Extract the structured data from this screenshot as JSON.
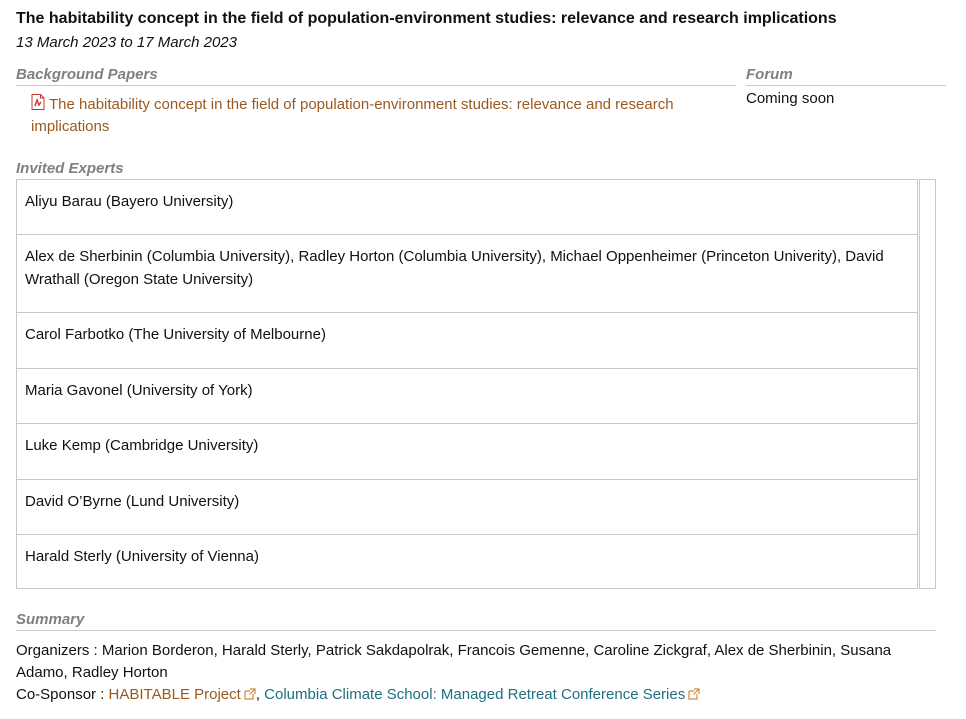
{
  "event": {
    "title": "The habitability concept in the field of population-environment studies: relevance and research implications",
    "dates": "13 March 2023 to 17 March 2023"
  },
  "background_papers": {
    "heading": "Background Papers",
    "items": [
      {
        "label": "The habitability concept in the field of population-environment studies: relevance and research implications",
        "icon": "pdf-icon"
      }
    ]
  },
  "forum": {
    "heading": "Forum",
    "text": "Coming soon"
  },
  "invited_experts": {
    "heading": "Invited Experts",
    "rows": [
      "Aliyu Barau (Bayero University)",
      "Alex de Sherbinin (Columbia University), Radley Horton (Columbia University), Michael Oppenheimer (Princeton Univerity), David Wrathall (Oregon State University)",
      "Carol Farbotko (The University of Melbourne)",
      "Maria Gavonel (University of York)",
      "Luke Kemp (Cambridge University)",
      "David O’Byrne (Lund University)",
      "Harald Sterly (University of Vienna)"
    ]
  },
  "summary": {
    "heading": "Summary",
    "organizers_label": "Organizers :",
    "organizers": "Marion Borderon, Harald Sterly, Patrick Sakdapolrak, Francois Gemenne, Caroline Zickgraf, Alex de Sherbinin, Susana Adamo, Radley Horton",
    "cosponsor_label": "Co-Sponsor :",
    "cosponsor_link1": "HABITABLE Project",
    "separator": ",",
    "cosponsor_link2": "Columbia Climate School: Managed Retreat Conference Series"
  },
  "colors": {
    "link_orange": "#9a5a1e",
    "link_teal": "#1f6f82",
    "heading_gray": "#808080",
    "border_gray": "#c8c8c8"
  }
}
